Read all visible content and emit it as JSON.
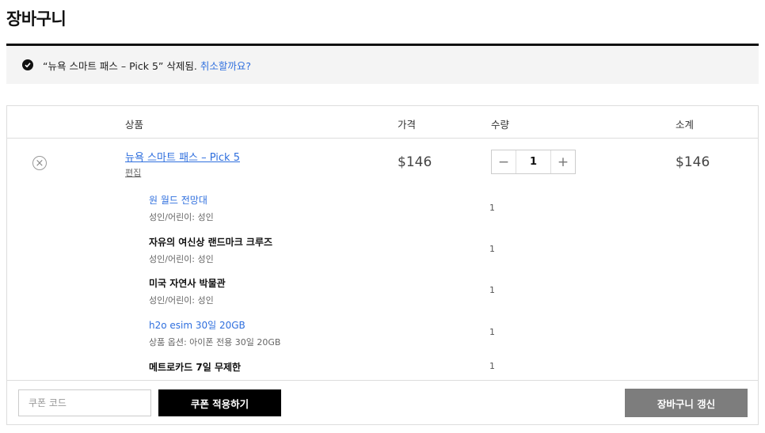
{
  "page": {
    "title": "장바구니"
  },
  "notice": {
    "message": "“뉴욕 스마트 패스 – Pick 5” 삭제됨.",
    "undo_link": "취소할까요?"
  },
  "table": {
    "headers": {
      "product": "상품",
      "price": "가격",
      "quantity": "수량",
      "subtotal": "소계"
    }
  },
  "cart_item": {
    "remove_symbol": "×",
    "name": "뉴욕 스마트 패스 – Pick 5",
    "edit_label": "편집",
    "price": "$146",
    "quantity": "1",
    "minus": "−",
    "plus": "+",
    "subtotal": "$146",
    "sub_items": [
      {
        "name": "원 월드 전망대",
        "meta": "성인/어린이: 성인",
        "qty": "1",
        "is_link": true
      },
      {
        "name": "자유의 여신상 랜드마크 크루즈",
        "meta": "성인/어린이: 성인",
        "qty": "1",
        "is_link": false
      },
      {
        "name": "미국 자연사 박물관",
        "meta": "성인/어린이: 성인",
        "qty": "1",
        "is_link": false
      },
      {
        "name": "h2o esim 30일 20GB",
        "meta": "상품 옵션: 아이폰 전용 30일 20GB",
        "qty": "1",
        "is_link": true
      },
      {
        "name": "메트로카드 7일 무제한",
        "meta": "",
        "qty": "1",
        "is_link": false
      }
    ]
  },
  "footer": {
    "coupon_placeholder": "쿠폰 코드",
    "coupon_button": "쿠폰 적용하기",
    "update_button": "장바구니 갱신"
  },
  "colors": {
    "link": "#2f6fde",
    "update_button_bg": "#7d7d7d",
    "coupon_button_bg": "#000000",
    "notice_bg": "#f4f4f4"
  }
}
